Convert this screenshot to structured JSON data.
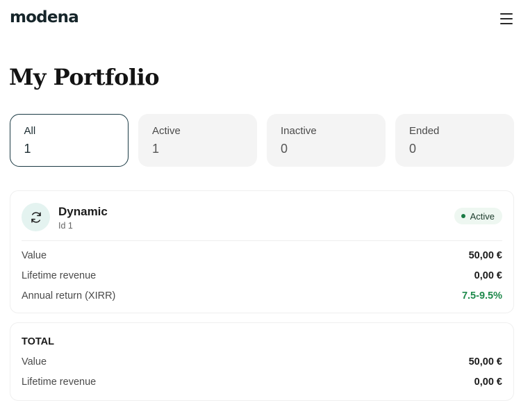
{
  "header": {
    "logo": "modena",
    "menu_icon": "hamburger-menu-icon"
  },
  "page": {
    "title": "My Portfolio"
  },
  "tabs": [
    {
      "label": "All",
      "count": "1",
      "selected": true
    },
    {
      "label": "Active",
      "count": "1",
      "selected": false
    },
    {
      "label": "Inactive",
      "count": "0",
      "selected": false
    },
    {
      "label": "Ended",
      "count": "0",
      "selected": false
    }
  ],
  "portfolio": {
    "icon": "refresh-cycle-icon",
    "name": "Dynamic",
    "id_label": "Id 1",
    "status": "Active",
    "status_color": "#1a7a44",
    "rows": [
      {
        "label": "Value",
        "value": "50,00 €"
      },
      {
        "label": "Lifetime revenue",
        "value": "0,00 €"
      },
      {
        "label": "Annual return (XIRR)",
        "value": "7.5-9.5%"
      }
    ]
  },
  "total": {
    "title": "TOTAL",
    "rows": [
      {
        "label": "Value",
        "value": "50,00 €"
      },
      {
        "label": "Lifetime revenue",
        "value": "0,00 €"
      }
    ]
  },
  "colors": {
    "accent": "#1b3a44",
    "positive": "#1f8a4c",
    "icon_bg": "#e4f3f0"
  }
}
